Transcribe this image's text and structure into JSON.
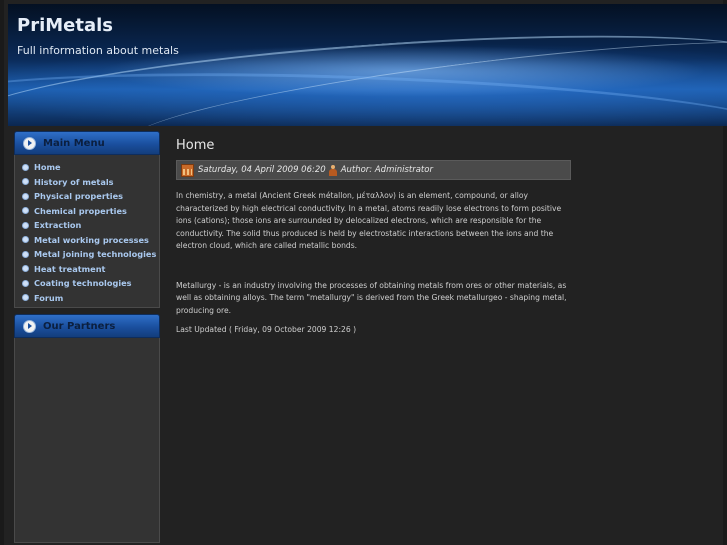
{
  "header": {
    "title": "PriMetals",
    "slogan": "Full information about metals"
  },
  "main_menu": {
    "title": "Main Menu",
    "items": [
      {
        "label": "Home"
      },
      {
        "label": "History of metals"
      },
      {
        "label": "Physical properties"
      },
      {
        "label": "Chemical properties"
      },
      {
        "label": "Extraction"
      },
      {
        "label": "Metal working processes"
      },
      {
        "label": "Metal joining technologies"
      },
      {
        "label": "Heat treatment"
      },
      {
        "label": "Coating technologies"
      },
      {
        "label": "Forum"
      }
    ]
  },
  "partners": {
    "title": "Our Partners"
  },
  "article": {
    "title": "Home",
    "date": "Saturday, 04 April 2009 06:20",
    "author": "Author: Administrator",
    "paragraph1": "In chemistry, a metal (Ancient Greek métallon, μέταλλον) is an element, compound, or alloy characterized by high electrical conductivity. In a metal, atoms readily lose electrons to form positive ions (cations); those ions are surrounded by delocalized electrons, which are responsible for the conductivity. The solid thus produced is held by electrostatic interactions between the ions and the electron cloud, which are called metallic bonds.",
    "paragraph2": "Metallurgy - is an industry involving the processes of obtaining metals from ores or other materials, as well as obtaining alloys. The term \"metallurgy\" is derived from the Greek metallurgeo - shaping metal, producing ore.",
    "last_updated": "Last Updated ( Friday, 09 October 2009 12:26 )"
  }
}
